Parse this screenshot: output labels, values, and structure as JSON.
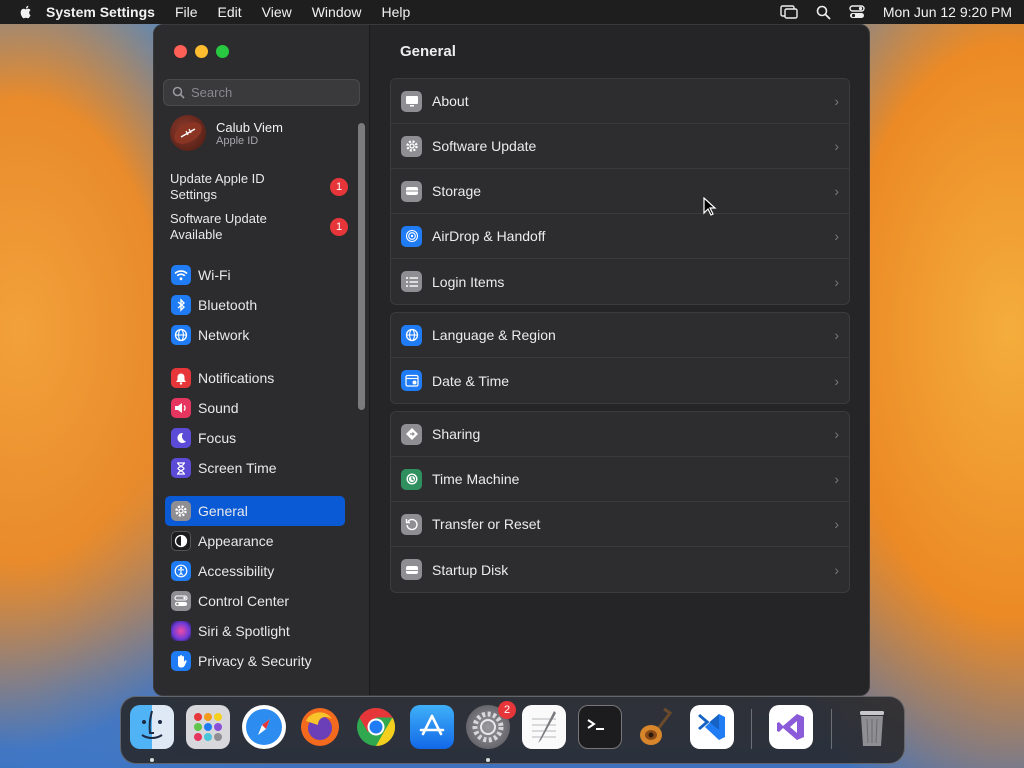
{
  "menubar": {
    "app_name": "System Settings",
    "items": [
      "File",
      "Edit",
      "View",
      "Window",
      "Help"
    ],
    "clock": "Mon Jun 12  9:20 PM"
  },
  "window": {
    "title": "General",
    "search": {
      "placeholder": "Search"
    },
    "account": {
      "name": "Calub Viem",
      "subtitle": "Apple ID"
    },
    "notices": [
      {
        "label": "Update Apple ID Settings",
        "badge": "1"
      },
      {
        "label": "Software Update Available",
        "badge": "1"
      }
    ],
    "sidebar_items": [
      {
        "label": "Wi-Fi",
        "icon": "wifi-icon",
        "color": "#1f7cf4"
      },
      {
        "label": "Bluetooth",
        "icon": "bluetooth-icon",
        "color": "#1f7cf4"
      },
      {
        "label": "Network",
        "icon": "globe-icon",
        "color": "#1f7cf4"
      },
      {
        "label": "Notifications",
        "icon": "bell-icon",
        "color": "#e6363a"
      },
      {
        "label": "Sound",
        "icon": "speaker-icon",
        "color": "#e6365f"
      },
      {
        "label": "Focus",
        "icon": "moon-icon",
        "color": "#5b4bd6"
      },
      {
        "label": "Screen Time",
        "icon": "hourglass-icon",
        "color": "#5b4bd6"
      },
      {
        "label": "General",
        "icon": "gear-icon",
        "color": "#8e8e93",
        "selected": true
      },
      {
        "label": "Appearance",
        "icon": "appearance-icon",
        "color": "#1c1c1e"
      },
      {
        "label": "Accessibility",
        "icon": "accessibility-icon",
        "color": "#1f7cf4"
      },
      {
        "label": "Control Center",
        "icon": "control-center-icon",
        "color": "#8e8e93"
      },
      {
        "label": "Siri & Spotlight",
        "icon": "siri-icon",
        "color": "#b04ad8"
      },
      {
        "label": "Privacy & Security",
        "icon": "hand-icon",
        "color": "#1f7cf4"
      }
    ],
    "groups": [
      [
        {
          "label": "About",
          "icon": "display-icon",
          "color": "#8e8e93"
        },
        {
          "label": "Software Update",
          "icon": "gear-icon",
          "color": "#8e8e93"
        },
        {
          "label": "Storage",
          "icon": "drive-icon",
          "color": "#8e8e93"
        },
        {
          "label": "AirDrop & Handoff",
          "icon": "airdrop-icon",
          "color": "#1f7cf4"
        },
        {
          "label": "Login Items",
          "icon": "list-icon",
          "color": "#8e8e93"
        }
      ],
      [
        {
          "label": "Language & Region",
          "icon": "globe-icon",
          "color": "#1f7cf4"
        },
        {
          "label": "Date & Time",
          "icon": "calendar-icon",
          "color": "#1f7cf4"
        }
      ],
      [
        {
          "label": "Sharing",
          "icon": "sharing-icon",
          "color": "#8e8e93"
        },
        {
          "label": "Time Machine",
          "icon": "time-machine-icon",
          "color": "#2f8f5f"
        },
        {
          "label": "Transfer or Reset",
          "icon": "reset-icon",
          "color": "#8e8e93"
        },
        {
          "label": "Startup Disk",
          "icon": "disk-icon",
          "color": "#8e8e93"
        }
      ]
    ]
  },
  "dock": {
    "system_settings_badge": "2",
    "apps": [
      "finder-icon",
      "launchpad-icon",
      "safari-icon",
      "firefox-icon",
      "chrome-icon",
      "app-store-icon",
      "system-settings-icon",
      "textedit-icon",
      "terminal-icon",
      "garageband-icon",
      "vscode-icon",
      "visual-studio-icon",
      "trash-icon"
    ]
  }
}
